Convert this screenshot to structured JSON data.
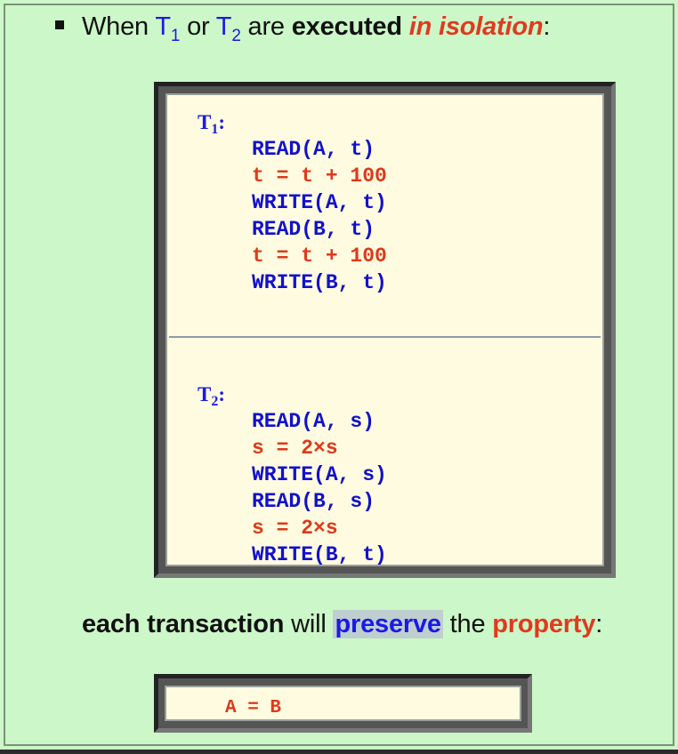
{
  "bullet": {
    "when": "When",
    "t": "T",
    "sub1": "1",
    "or": "or",
    "sub2": "2",
    "are": "are",
    "executed": "executed",
    "in_isolation": "in isolation",
    "colon": ":"
  },
  "code": {
    "t1_label": "T",
    "t1_sub": "1",
    "t1_colon": ":",
    "t1_lines": [
      "READ(A, t)",
      "t = t + 100",
      "WRITE(A, t)",
      "READ(B, t)",
      "t = t + 100",
      "WRITE(B, t)"
    ],
    "t2_label": "T",
    "t2_sub": "2",
    "t2_colon": ":",
    "t2_lines": [
      "READ(A, s)",
      "s = 2×s",
      "WRITE(A, s)",
      "READ(B, s)",
      "s = 2×s",
      "WRITE(B, t)"
    ]
  },
  "summary": {
    "each_transaction": "each transaction",
    "will": "will",
    "preserve": "preserve",
    "the": "the",
    "property": "property",
    "colon": ":"
  },
  "equation": "A = B",
  "colors": {
    "background": "#ccf7c8",
    "code_bg": "#fffbe0",
    "blue": "#1111cc",
    "red": "#dd3a1c",
    "highlight": "#bfcfcf"
  }
}
